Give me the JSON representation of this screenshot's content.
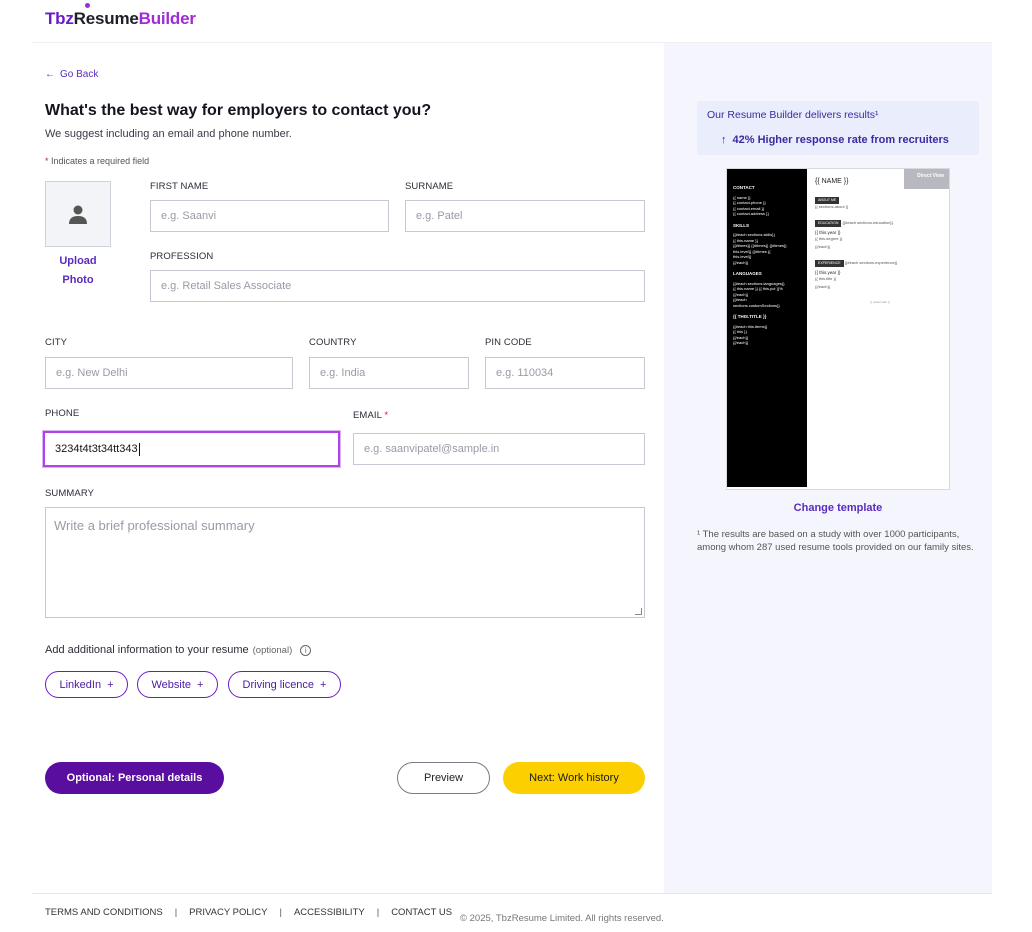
{
  "header": {
    "logo_part1": "Tbz",
    "logo_part2": "Resume",
    "logo_part3": "Builder"
  },
  "nav": {
    "back_label": "Go Back"
  },
  "form": {
    "title": "What's the best way for employers to contact you?",
    "subtitle": "We suggest including an email and phone number.",
    "required_note": "Indicates a required field",
    "upload_photo_label": "Upload Photo",
    "first_name": {
      "label": "First name",
      "placeholder": "e.g. Saanvi",
      "value": ""
    },
    "surname": {
      "label": "Surname",
      "placeholder": "e.g. Patel",
      "value": ""
    },
    "profession": {
      "label": "Profession",
      "placeholder": "e.g. Retail Sales Associate",
      "value": ""
    },
    "city": {
      "label": "City",
      "placeholder": "e.g. New Delhi",
      "value": ""
    },
    "country": {
      "label": "Country",
      "placeholder": "e.g. India",
      "value": ""
    },
    "pin_code": {
      "label": "Pin code",
      "placeholder": "e.g. 110034",
      "value": ""
    },
    "phone": {
      "label": "Phone",
      "value": "3234t4t3t34tt343"
    },
    "email": {
      "label": "Email",
      "placeholder": "e.g. saanvipatel@sample.in",
      "value": ""
    },
    "summary": {
      "label": "Summary",
      "placeholder": "Write a brief professional summary"
    },
    "additional_info": {
      "label": "Add additional information to your resume",
      "optional": "(optional)"
    },
    "chips": [
      {
        "label": "LinkedIn",
        "plus": "+"
      },
      {
        "label": "Website",
        "plus": "+"
      },
      {
        "label": "Driving licence",
        "plus": "+"
      }
    ],
    "buttons": {
      "personal": "Optional: Personal details",
      "preview": "Preview",
      "next": "Next: Work history"
    }
  },
  "sidebar": {
    "results_title": "Our Resume Builder delivers results¹",
    "results_stat": "42% Higher response rate from recruiters",
    "change_template": "Change template",
    "footnote": "¹ The results are based on a study with over 1000 participants, among whom 287 used resume tools provided on our family sites."
  },
  "preview": {
    "badge": "Direct View",
    "side": {
      "contact_h": "CONTACT",
      "contact_lines": [
        "{{ name }}",
        "{{ contact.phone }}",
        "{{ contact.email }}",
        "{{ contact.address }}"
      ],
      "skills_h": "SKILLS",
      "skills_lines": [
        "{{#each sections.skills}}",
        "{{ this.name }}",
        "{{#times}} {{#times}} {{#times}}",
        "this.level}} {{#times {{",
        "this.level}}",
        "{{/each}}"
      ],
      "languages_h": "LANGUAGES",
      "languages_lines": [
        "{{#each sections.languages}}",
        "{{ this.name }} {{ this.pct }}%",
        "{{/each}}",
        "{{#each",
        "sections.customSections}}"
      ],
      "title_h": "{{ THIS.TITLE }}",
      "title_lines": [
        "{{#each this.items}}",
        "{{ this }}",
        "{{/each}}",
        "{{/each}}"
      ]
    },
    "main": {
      "name": "{{ NAME }}",
      "about_tag": "ABOUT ME",
      "about_line": "{{ sections.about }}",
      "education_tag": "EDUCATION",
      "education_line": "{{#each sections.education}}",
      "education_year": "{{ this.year }}",
      "education_title": "{{ this.degree }}",
      "education_end": "{{/each}}",
      "experience_tag": "EXPERIENCE",
      "experience_line": "{{#each sections.experience}}",
      "experience_year": "{{ this.year }}",
      "experience_title": "{{ this.title }}",
      "experience_end": "{{/each}}",
      "watermark": "{{ watermark }}"
    }
  },
  "footer": {
    "links": [
      "TERMS AND CONDITIONS",
      "PRIVACY POLICY",
      "ACCESSIBILITY",
      "CONTACT US"
    ],
    "copyright": "© 2025, TbzResume Limited. All rights reserved."
  },
  "colors": {
    "brand_purple": "#6a1cc8",
    "accent_yellow": "#fcd000",
    "focus_border": "#b141e8"
  }
}
